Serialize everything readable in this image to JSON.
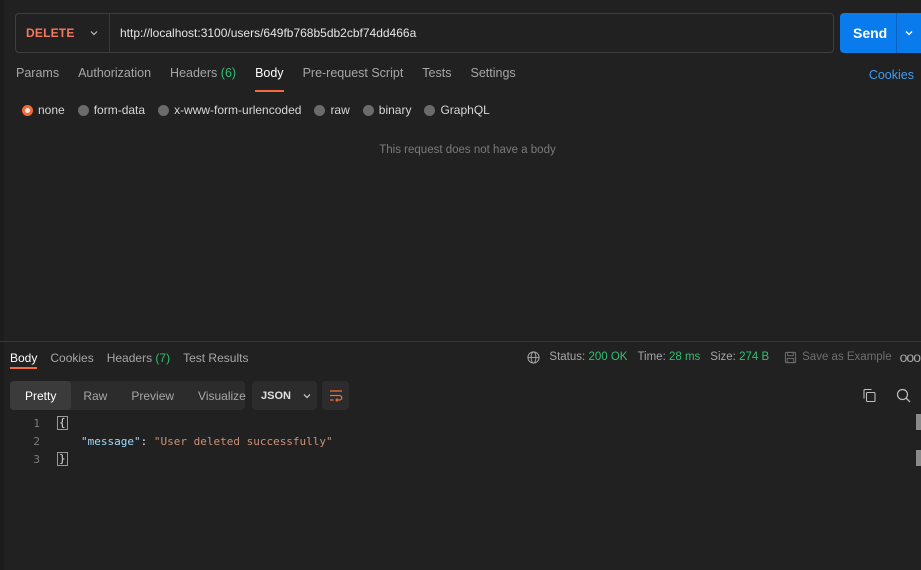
{
  "request": {
    "method": "DELETE",
    "url": "http://localhost:3100/users/649fb768b5db2cbf74dd466a",
    "send_label": "Send"
  },
  "request_tabs": {
    "params": "Params",
    "authorization": "Authorization",
    "headers": "Headers",
    "headers_count": "(6)",
    "body": "Body",
    "pre_request": "Pre-request Script",
    "tests": "Tests",
    "settings": "Settings"
  },
  "cookies_link": "Cookies",
  "body_types": {
    "none": "none",
    "form_data": "form-data",
    "urlencoded": "x-www-form-urlencoded",
    "raw": "raw",
    "binary": "binary",
    "graphql": "GraphQL",
    "selected": "none"
  },
  "empty_body_message": "This request does not have a body",
  "response_tabs": {
    "body": "Body",
    "cookies": "Cookies",
    "headers": "Headers",
    "headers_count": "(7)",
    "test_results": "Test Results"
  },
  "response_meta": {
    "status_label": "Status:",
    "status_value": "200 OK",
    "time_label": "Time:",
    "time_value": "28 ms",
    "size_label": "Size:",
    "size_value": "274 B",
    "save_example": "Save as Example"
  },
  "view_modes": {
    "pretty": "Pretty",
    "raw": "Raw",
    "preview": "Preview",
    "visualize": "Visualize"
  },
  "format": "JSON",
  "code": {
    "line1": "1",
    "line2": "2",
    "line3": "3",
    "open_brace": "{",
    "close_brace": "}",
    "key": "\"message\"",
    "colon": ": ",
    "value": "\"User deleted successfully\""
  },
  "colors": {
    "method": "#f2785f",
    "send": "#097bed",
    "active_tab_underline": "#f26b3a",
    "success": "#2fbf71",
    "link": "#3d9df5"
  }
}
